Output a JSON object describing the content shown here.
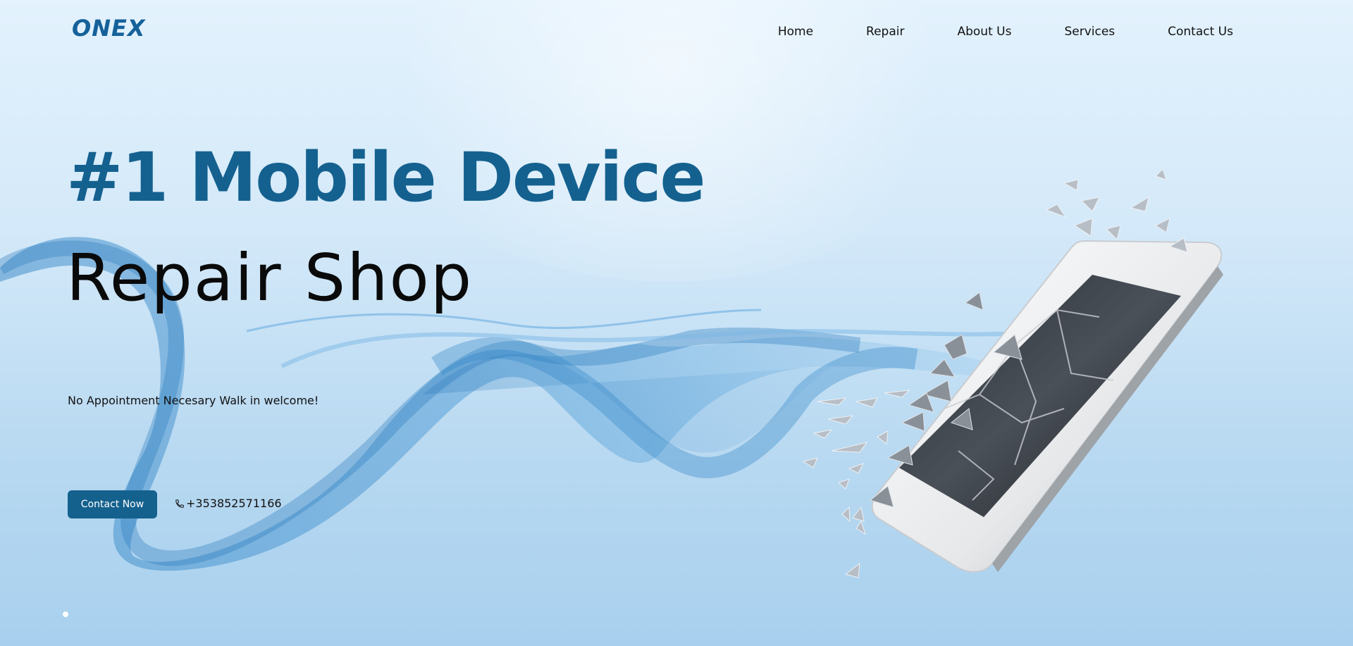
{
  "brand": {
    "logo_text": "ONEX"
  },
  "nav": {
    "items": [
      {
        "label": "Home"
      },
      {
        "label": "Repair"
      },
      {
        "label": "About Us"
      },
      {
        "label": "Services"
      },
      {
        "label": "Contact Us"
      }
    ]
  },
  "hero": {
    "title_line1": "#1 Mobile Device",
    "title_line2": "Repair Shop",
    "tagline": "No Appointment Necesary Walk in welcome!",
    "cta_label": "Contact Now",
    "phone": "+353852571166"
  },
  "colors": {
    "accent": "#15618e",
    "title_blue": "#14618f",
    "background": "#d4e9f9"
  },
  "icons": {
    "phone": "phone-icon"
  }
}
